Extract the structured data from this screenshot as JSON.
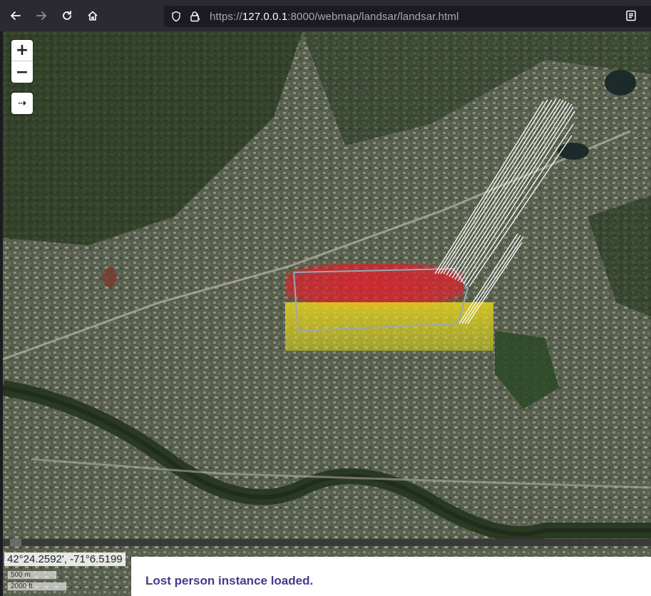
{
  "browser": {
    "url_prefix": "https://",
    "url_host": "127.0.0.1",
    "url_rest": ":8000/webmap/landsar/landsar.html"
  },
  "map": {
    "zoom_in_label": "+",
    "zoom_out_label": "−",
    "extra_control_label": "⇢",
    "coordinates": "42°24.2592', -71°6.5199",
    "scale_metric": "500 m",
    "scale_imperial": "2000 ft"
  },
  "status": {
    "message": "Lost person instance loaded."
  },
  "icons": {
    "back": "arrow-left-icon",
    "forward": "arrow-right-icon",
    "reload": "reload-icon",
    "home": "home-icon",
    "shield": "shield-icon",
    "lock": "lock-icon",
    "reader": "reader-view-icon"
  },
  "colors": {
    "heat_high": "#e0202a",
    "heat_mid": "#e8d21f",
    "status_text": "#453b8c",
    "search_area_outline": "#9aa7b8"
  }
}
